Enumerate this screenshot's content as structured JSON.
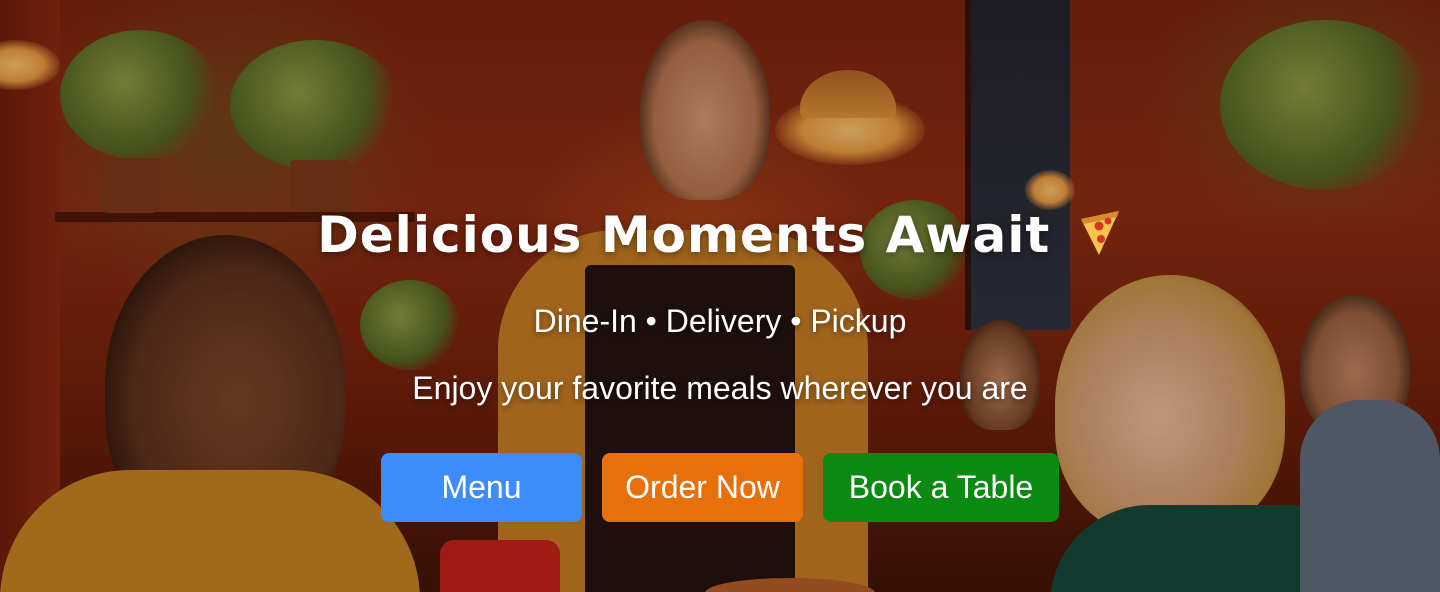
{
  "hero": {
    "title": "Delicious Moments Await",
    "title_icon": "pizza-icon",
    "subtitle": "Dine-In • Delivery • Pickup",
    "tagline": "Enjoy your favorite meals wherever you are",
    "background": "restaurant-photo-with-diners-and-server"
  },
  "buttons": [
    {
      "label": "Menu",
      "color": "#3d8bfd"
    },
    {
      "label": "Order Now",
      "color": "#e8700a"
    },
    {
      "label": "Book a Table",
      "color": "#0a8a10"
    }
  ]
}
